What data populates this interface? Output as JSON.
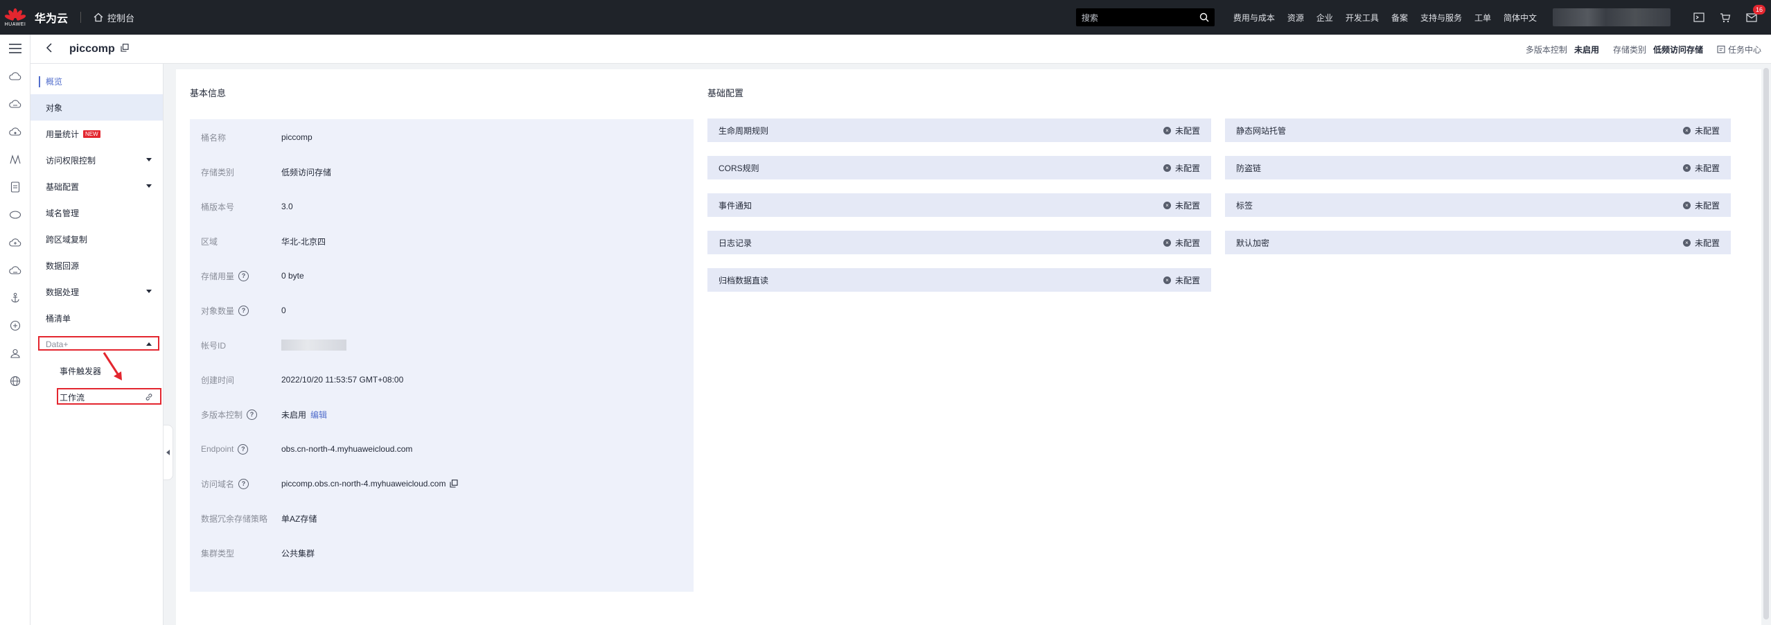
{
  "topbar": {
    "brand": "华为云",
    "logo_text": "HUAWEI",
    "console": "控制台",
    "search_placeholder": "搜索",
    "menu": [
      "费用与成本",
      "资源",
      "企业",
      "开发工具",
      "备案",
      "支持与服务",
      "工单",
      "简体中文"
    ],
    "notif_count": "16"
  },
  "header": {
    "bucket_name": "piccomp",
    "versioning_label": "多版本控制",
    "versioning_value": "未启用",
    "storage_class_label": "存储类别",
    "storage_class_value": "低频访问存储",
    "task_center": "任务中心"
  },
  "sidebar": {
    "items": [
      {
        "label": "概览"
      },
      {
        "label": "对象"
      },
      {
        "label": "用量统计",
        "tag": "NEW"
      },
      {
        "label": "访问权限控制"
      },
      {
        "label": "基础配置"
      },
      {
        "label": "域名管理"
      },
      {
        "label": "跨区域复制"
      },
      {
        "label": "数据回源"
      },
      {
        "label": "数据处理"
      },
      {
        "label": "桶清单"
      },
      {
        "label": "Data+"
      },
      {
        "label": "事件触发器"
      },
      {
        "label": "工作流"
      }
    ]
  },
  "basic_info": {
    "title": "基本信息",
    "rows": [
      {
        "k": "桶名称",
        "v": "piccomp"
      },
      {
        "k": "存储类别",
        "v": "低频访问存储"
      },
      {
        "k": "桶版本号",
        "v": "3.0"
      },
      {
        "k": "区域",
        "v": "华北-北京四"
      },
      {
        "k": "存储用量",
        "v": "0 byte"
      },
      {
        "k": "对象数量",
        "v": "0"
      },
      {
        "k": "帐号ID",
        "v": ""
      },
      {
        "k": "创建时间",
        "v": "2022/10/20 11:53:57 GMT+08:00"
      },
      {
        "k": "多版本控制",
        "v": "未启用",
        "link": "编辑"
      },
      {
        "k": "Endpoint",
        "v": "obs.cn-north-4.myhuaweicloud.com"
      },
      {
        "k": "访问域名",
        "v": "piccomp.obs.cn-north-4.myhuaweicloud.com"
      },
      {
        "k": "数据冗余存储策略",
        "v": "单AZ存储"
      },
      {
        "k": "集群类型",
        "v": "公共集群"
      }
    ]
  },
  "basic_config": {
    "title": "基础配置",
    "status": "未配置",
    "left": [
      "生命周期规则",
      "CORS规则",
      "事件通知",
      "日志记录",
      "归档数据直读"
    ],
    "right": [
      "静态网站托管",
      "防盗链",
      "标签",
      "默认加密"
    ]
  },
  "colors": {
    "accent": "#526ecc",
    "highlight": "#e3262f",
    "topbar": "#1f2329"
  }
}
